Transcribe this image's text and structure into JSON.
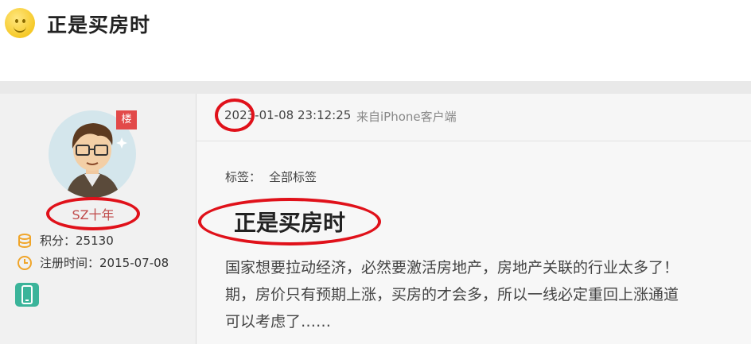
{
  "header": {
    "icon": "smiley-icon",
    "title": "正是买房时"
  },
  "sidebar": {
    "floor_badge": "楼",
    "username": "SZ十年",
    "points_label": "积分：",
    "points_value": "25130",
    "register_label": "注册时间：",
    "register_value": "2015-07-08",
    "device_icon": "mobile-phone-icon"
  },
  "post": {
    "time": "2023-01-08 23:12:25",
    "source": "来自iPhone客户端",
    "tags_label": "标签：",
    "tags_value": "全部标签",
    "title": "正是买房时",
    "body_lines": [
      "国家想要拉动经济，必然要激活房地产，房地产关联的行业太多了！",
      "期，房价只有预期上涨，买房的才会多，所以一线必定重回上涨通道",
      "可以考虑了……"
    ]
  },
  "colors": {
    "annotation_red": "#e0111a",
    "username": "#c04a4a",
    "floor_badge": "#e24a4a",
    "device_badge": "#3bb49a"
  }
}
